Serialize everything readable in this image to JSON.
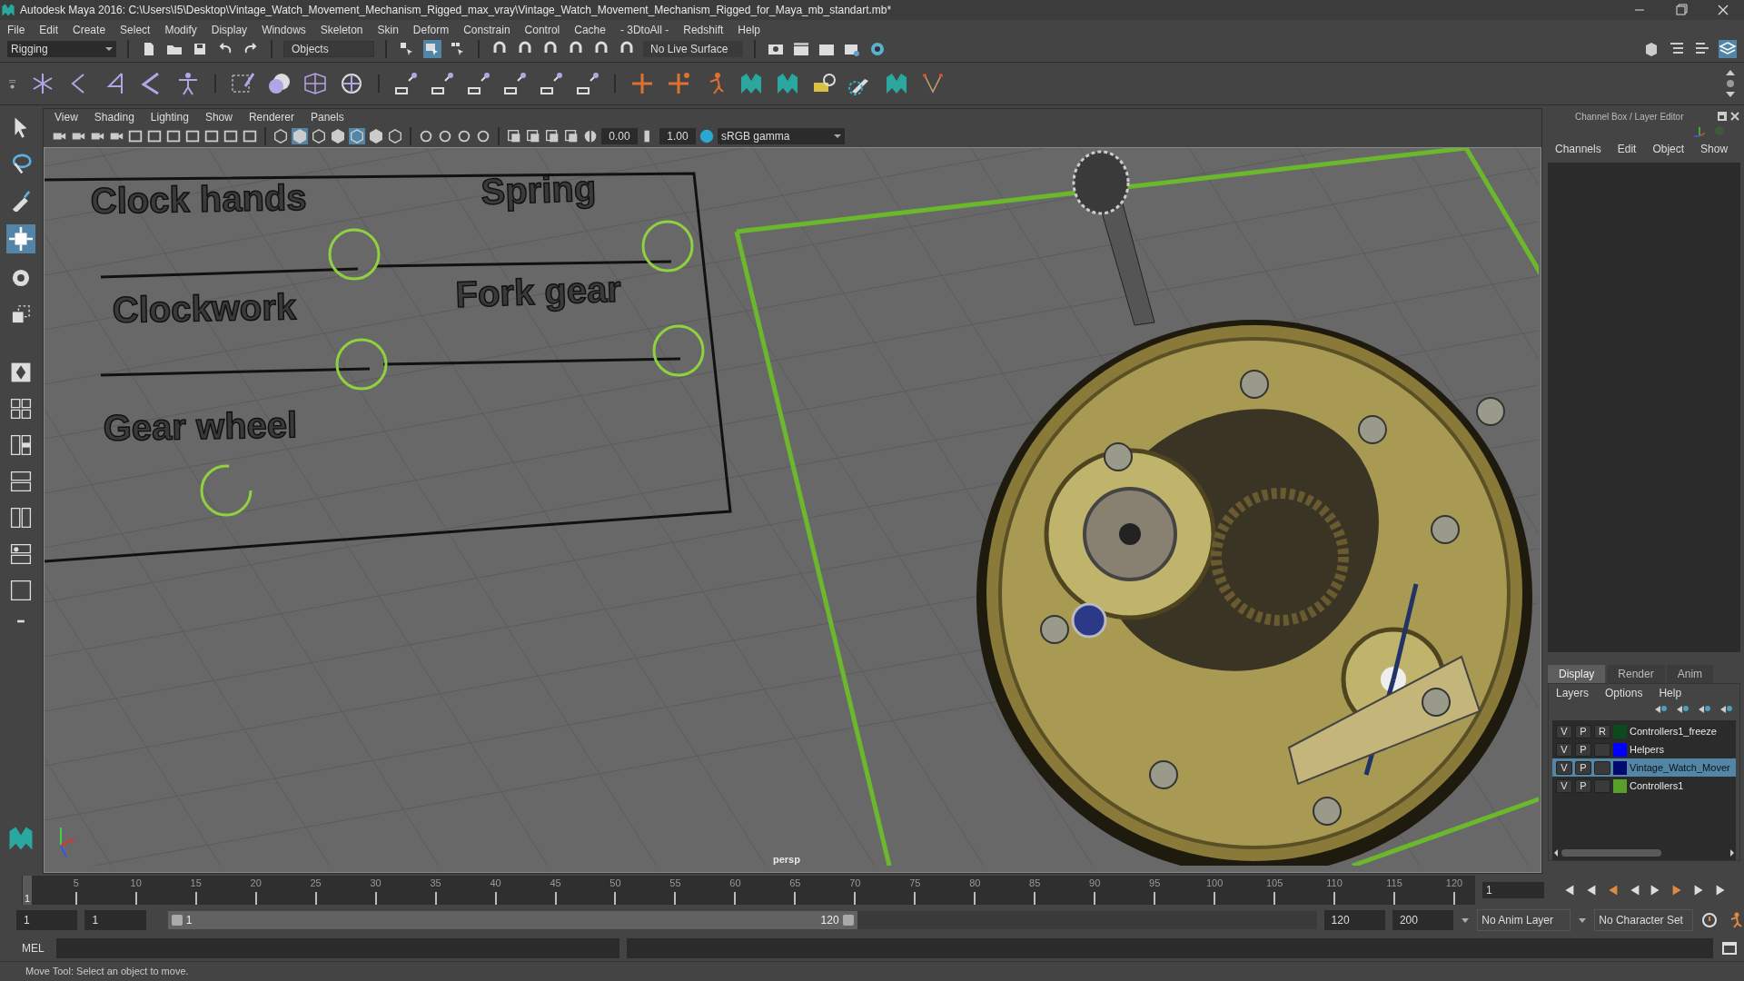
{
  "window": {
    "title": "Autodesk Maya 2016: C:\\Users\\I5\\Desktop\\Vintage_Watch_Movement_Mechanism_Rigged_max_vray\\Vintage_Watch_Movement_Mechanism_Rigged_for_Maya_mb_standart.mb*"
  },
  "menu_bar": [
    "File",
    "Edit",
    "Create",
    "Select",
    "Modify",
    "Display",
    "Windows",
    "Skeleton",
    "Skin",
    "Deform",
    "Constrain",
    "Control",
    "Cache",
    "- 3DtoAll -",
    "Redshift",
    "Help"
  ],
  "status_line": {
    "menu_set": "Rigging",
    "selection_mode": "Objects",
    "live_surface": "No Live Surface"
  },
  "viewport": {
    "menu": [
      "View",
      "Shading",
      "Lighting",
      "Show",
      "Renderer",
      "Panels"
    ],
    "exposure": "0.00",
    "gamma": "1.00",
    "color_space": "sRGB gamma",
    "camera": "persp",
    "labels": [
      "Clock hands",
      "Spring",
      "Clockwork",
      "Fork gear",
      "Gear wheel"
    ]
  },
  "channel_box": {
    "title": "Channel Box / Layer Editor",
    "menu": [
      "Channels",
      "Edit",
      "Object",
      "Show"
    ]
  },
  "layer_editor": {
    "tabs": [
      {
        "label": "Display",
        "selected": true
      },
      {
        "label": "Render",
        "selected": false
      },
      {
        "label": "Anim",
        "selected": false
      }
    ],
    "menu": [
      "Layers",
      "Options",
      "Help"
    ],
    "layers": [
      {
        "visible": "V",
        "playback": "P",
        "reference": "R",
        "color": "#0b4a1e",
        "name": "Controllers1_freeze",
        "selected": false
      },
      {
        "visible": "V",
        "playback": "P",
        "color": "#0000ff",
        "name": "Helpers",
        "selected": false
      },
      {
        "visible": "V",
        "playback": "P",
        "color": "#000a6e",
        "name": "Vintage_Watch_Mover",
        "selected": true
      },
      {
        "visible": "V",
        "playback": "P",
        "color": "#5a9e2c",
        "name": "Controllers1",
        "selected": false
      }
    ]
  },
  "time_slider": {
    "ticks": [
      "5",
      "10",
      "15",
      "20",
      "25",
      "30",
      "35",
      "40",
      "45",
      "50",
      "55",
      "60",
      "65",
      "70",
      "75",
      "80",
      "85",
      "90",
      "95",
      "100",
      "105",
      "110",
      "115",
      "120"
    ],
    "current_frame": "1",
    "frame_field": "1"
  },
  "range_slider": {
    "level": 0.6,
    "start": "1",
    "playback_start": "1",
    "range_start": "1",
    "range_end": "120",
    "playback_end": "120",
    "end": "200",
    "anim_layer": "No Anim Layer",
    "character_set": "No Character Set"
  },
  "command_line": {
    "label": "MEL"
  },
  "help_line": "Move Tool: Select an object to move."
}
